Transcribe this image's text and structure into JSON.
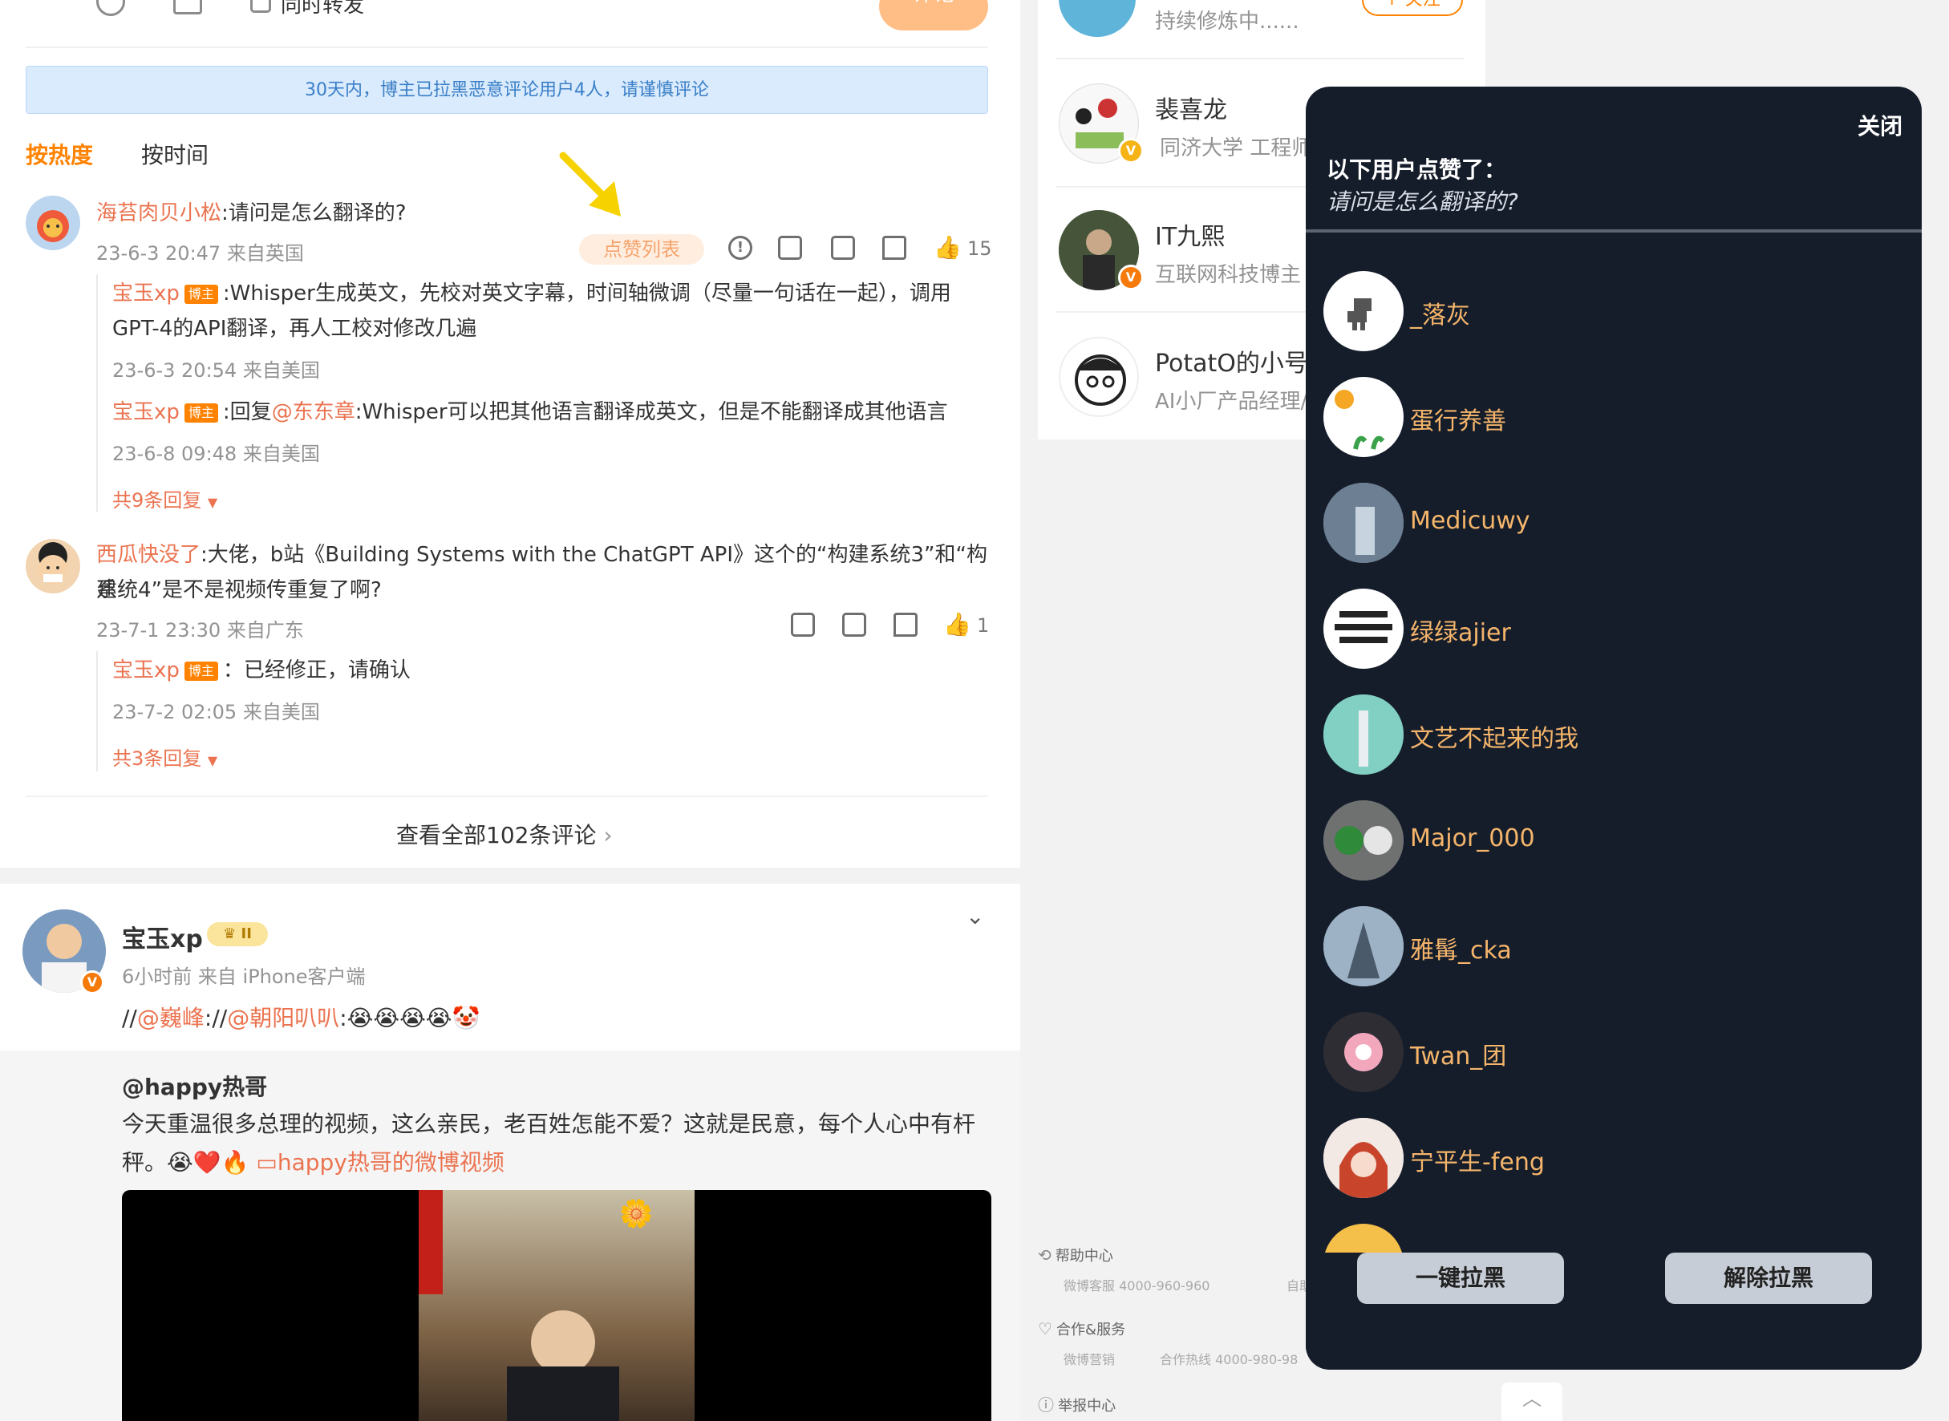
{
  "composer": {
    "sync_repost_label": "同时转发",
    "submit_label": "评论"
  },
  "notice": "30天内，博主已拉黑恶意评论用户4人，请谨慎评论",
  "sort_tabs": {
    "hot": "按热度",
    "time": "按时间"
  },
  "comments": [
    {
      "user": "海苔肉贝小松",
      "text": ":请问是怎么翻译的?",
      "meta": "23-6-3 20:47 来自英国",
      "like_list_label": "点赞列表",
      "likes": "15",
      "replies": [
        {
          "user": "宝玉xp",
          "badge": "博主",
          "text_line1": ":Whisper生成英文，先校对英文字幕，时间轴微调（尽量一句话在一起），调用",
          "text_line2": "GPT-4的API翻译，再人工校对修改几遍",
          "meta": "23-6-3 20:54 来自美国"
        },
        {
          "user": "宝玉xp",
          "badge": "博主",
          "reply_prefix": ":回复",
          "mention": "@东东章",
          "text": ":Whisper可以把其他语言翻译成英文，但是不能翻译成其他语言",
          "meta": "23-6-8 09:48 来自美国"
        }
      ],
      "more_replies": "共9条回复"
    },
    {
      "user": "西瓜快没了",
      "text_line1": ":大佬，b站《Building Systems with the ChatGPT API》这个的“构建系统3”和“构建",
      "text_line2": "系统4”是不是视频传重复了啊?",
      "meta": "23-7-1 23:30 来自广东",
      "likes": "1",
      "replies": [
        {
          "user": "宝玉xp",
          "badge": "博主",
          "text": "：已经修正，请确认",
          "meta": "23-7-2 02:05 来自美国"
        }
      ],
      "more_replies": "共3条回复"
    }
  ],
  "view_all": "查看全部102条评论",
  "post": {
    "author": "宝玉xp",
    "level_badge": "II",
    "meta": "6小时前  来自 iPhone客户端",
    "repost_text_prefix": "//",
    "mention1": "@巍峰",
    "sep": "://",
    "mention2": "@朝阳叭叭",
    "emoji_tail": ":😭😭😭😭🤡",
    "original_author": "@happy热哥",
    "original_line1": "今天重温很多总理的视频，这么亲民，老百姓怎能不爱？这就是民意，每个人心中有杆",
    "original_line2": "秤。😭❤️🔥",
    "video_link": "happy热哥的微博视频"
  },
  "suggestions": [
    {
      "name": "",
      "sub": "持续修炼中......",
      "follow": "+ 关注"
    },
    {
      "name": "裴喜龙",
      "sub": "同济大学 工程师"
    },
    {
      "name": "IT九熙",
      "sub": "互联网科技博主"
    },
    {
      "name": "PotatO的小号",
      "sub": "AI小厂产品经理/"
    }
  ],
  "footer": {
    "help_title": "帮助中心",
    "help_sub": "微博客服 4000-960-960",
    "help_sub2": "自助",
    "coop_title": "合作&服务",
    "coop_sub1": "微博营销",
    "coop_sub2": "合作热线 4000-980-98",
    "report_title": "举报中心"
  },
  "modal": {
    "close_label": "关闭",
    "title": "以下用户点赞了：",
    "subtitle": "请问是怎么翻译的?",
    "users": [
      "_落灰",
      "蛋行养善",
      "Medicuwy",
      "绿绿ajier",
      "文艺不起来的我",
      "Major_000",
      "雅髯_cka",
      "Twan_团",
      "宁平生-feng"
    ],
    "block_all": "一键拉黑",
    "unblock": "解除拉黑"
  },
  "colors": {
    "accent": "#ff8200",
    "name_link": "#eb7350",
    "modal_bg": "#151d2b",
    "modal_name": "#f5b56a",
    "notice_bg": "#d9ebfd",
    "arrow": "#f6d200"
  }
}
